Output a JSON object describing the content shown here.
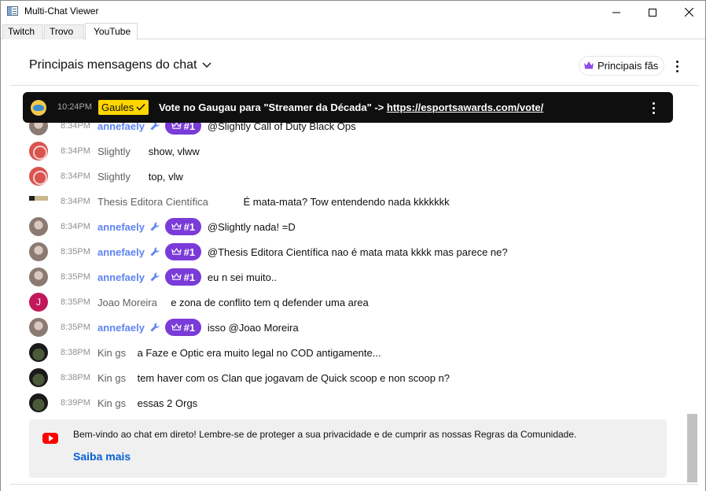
{
  "window": {
    "title": "Multi-Chat Viewer"
  },
  "tabs": [
    {
      "label": "Twitch"
    },
    {
      "label": "Trovo"
    },
    {
      "label": "YouTube",
      "active": true
    }
  ],
  "header": {
    "title": "Principais mensagens do chat",
    "fans_button": "Principais fãs"
  },
  "pinned": {
    "time": "10:24PM",
    "author": "Gaules",
    "text": "Vote no Gaugau para \"Streamer da Década\" -> ",
    "link": "https://esportsawards.com/vote/"
  },
  "messages": [
    {
      "time": "8:34PM",
      "author": "annefaely",
      "mod": true,
      "badge": "#1",
      "text": "@Slightly Call of Duty Black Ops",
      "avatar": "anne"
    },
    {
      "time": "8:34PM",
      "author": "Slightly",
      "mod": false,
      "text": "show, vlww",
      "avatar": "slightly"
    },
    {
      "time": "8:34PM",
      "author": "Slightly",
      "mod": false,
      "text": "top, vlw",
      "avatar": "slightly"
    },
    {
      "time": "8:34PM",
      "author": "Thesis Editora Científica",
      "mod": false,
      "text": "É mata-mata? Tow entendendo nada kkkkkkk",
      "avatar": "thesis"
    },
    {
      "time": "8:34PM",
      "author": "annefaely",
      "mod": true,
      "badge": "#1",
      "text": "@Slightly nada! =D",
      "avatar": "anne"
    },
    {
      "time": "8:35PM",
      "author": "annefaely",
      "mod": true,
      "badge": "#1",
      "text": "@Thesis Editora Científica nao é mata mata kkkk mas parece ne?",
      "avatar": "anne"
    },
    {
      "time": "8:35PM",
      "author": "annefaely",
      "mod": true,
      "badge": "#1",
      "text": "eu n sei muito..",
      "avatar": "anne"
    },
    {
      "time": "8:35PM",
      "author": "Joao Moreira",
      "mod": false,
      "text": "e zona de conflito tem q defender uma area",
      "avatar": "joao",
      "initial": "J"
    },
    {
      "time": "8:35PM",
      "author": "annefaely",
      "mod": true,
      "badge": "#1",
      "text": "isso @Joao Moreira",
      "avatar": "anne"
    },
    {
      "time": "8:38PM",
      "author": "Kin gs",
      "mod": false,
      "text": "a Faze e Optic era muito legal no COD antigamente...",
      "avatar": "kin"
    },
    {
      "time": "8:38PM",
      "author": "Kin gs",
      "mod": false,
      "text": "tem haver com os Clan que jogavam de Quick scoop e non scoop n?",
      "avatar": "kin"
    },
    {
      "time": "8:39PM",
      "author": "Kin gs",
      "mod": false,
      "text": "essas 2 Orgs",
      "avatar": "kin"
    }
  ],
  "welcome": {
    "text": "Bem-vindo ao chat em direto! Lembre-se de proteger a sua privacidade e de cumprir as nossas Regras da Comunidade.",
    "link": "Saiba mais"
  },
  "colors": {
    "moderator": "#5e84f1",
    "member_badge": "#7a3bd8",
    "owner_badge": "#ffd600",
    "link": "#065fd4"
  }
}
